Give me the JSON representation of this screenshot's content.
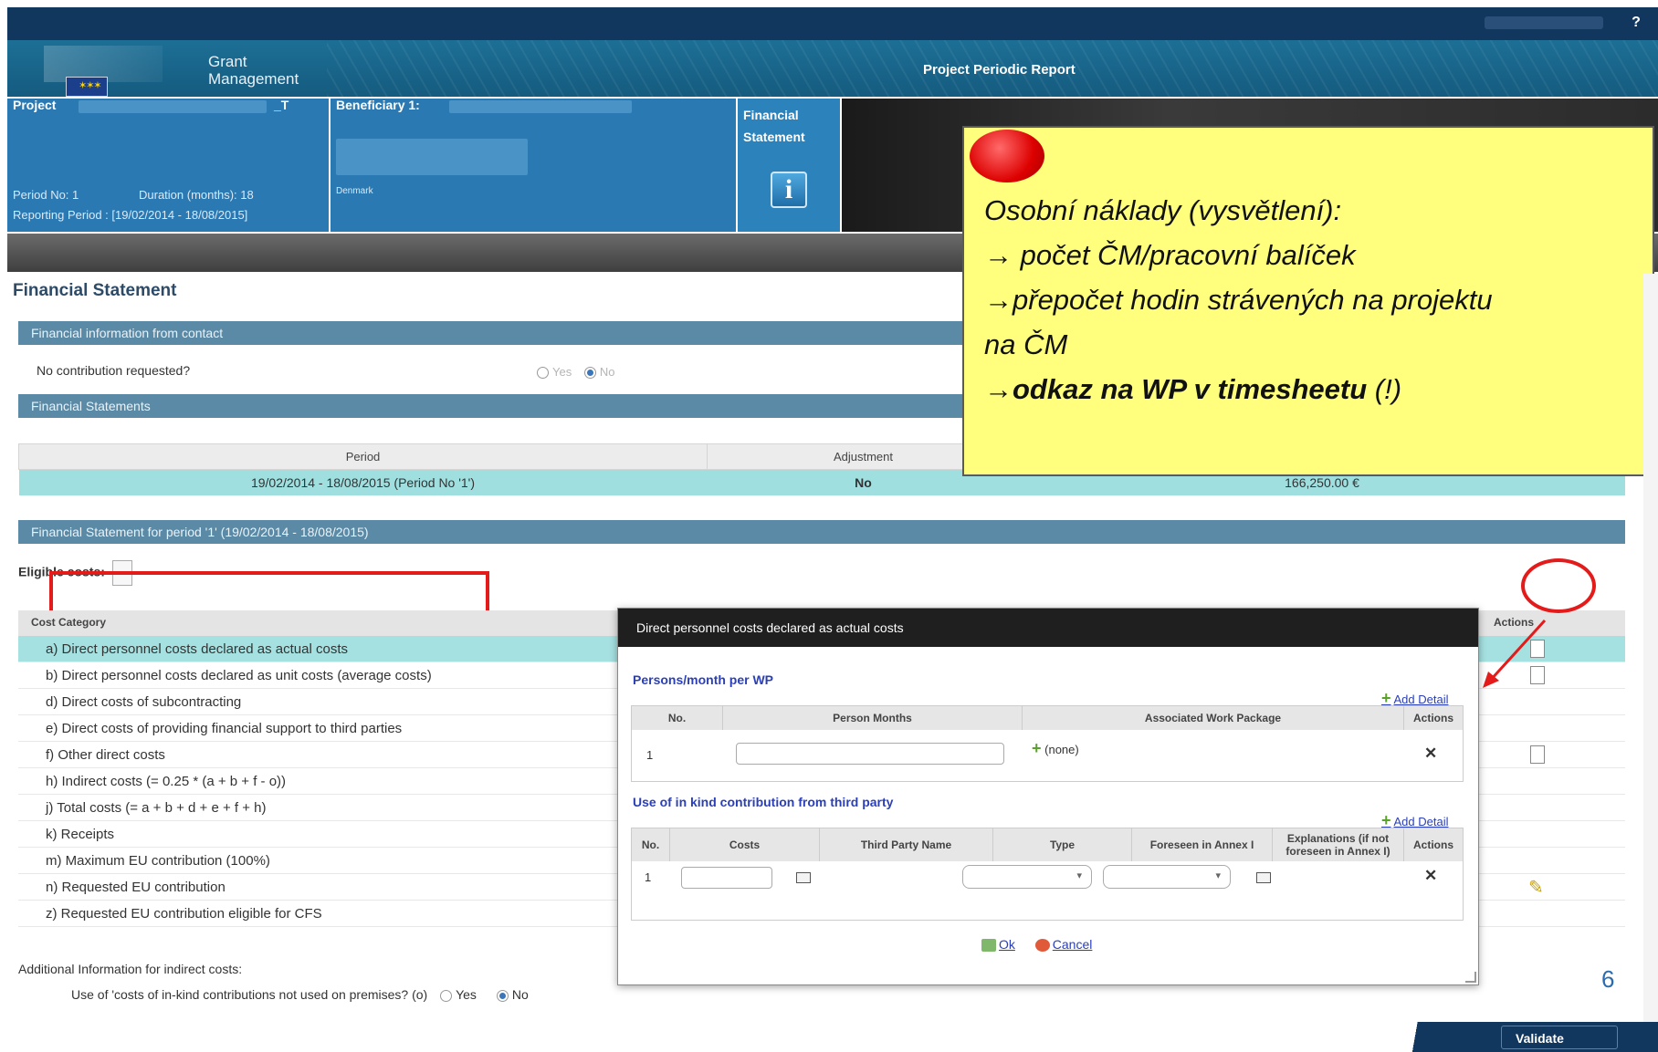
{
  "topbar": {
    "help_label": "?"
  },
  "header": {
    "app_name_line1": "Grant",
    "app_name_line2": "Management",
    "page_title": "Project Periodic Report"
  },
  "project": {
    "label": "Project",
    "acronym_suffix": "_T",
    "period_no": "Period No: 1",
    "duration": "Duration (months): 18",
    "reporting_period": "Reporting Period : [19/02/2014 - 18/08/2015]"
  },
  "beneficiary": {
    "label": "Beneficiary 1:",
    "country": "Denmark"
  },
  "financial_tab": {
    "line1": "Financial",
    "line2": "Statement",
    "icon": "info-icon"
  },
  "section_title": "Financial Statement",
  "fin_info": {
    "header": "Financial information from contact",
    "question": "No contribution requested?",
    "opt_yes": "Yes",
    "opt_no": "No"
  },
  "fin_statements": {
    "header": "Financial Statements",
    "col_period": "Period",
    "col_adjustment": "Adjustment",
    "row_period": "19/02/2014 - 18/08/2015 (Period No '1')",
    "row_adjustment": "No",
    "row_amount": "166,250.00 €"
  },
  "period_statement": {
    "header": "Financial Statement for period '1' (19/02/2014 - 18/08/2015)",
    "eligible_label": "Eligible costs:",
    "col_category": "Cost Category",
    "col_actions": "Actions",
    "rows": [
      {
        "label": "a) Direct personnel costs declared as actual costs",
        "action": "doc"
      },
      {
        "label": "b) Direct personnel costs declared as unit costs (average costs)",
        "action": "doc"
      },
      {
        "label": "d) Direct costs of subcontracting",
        "action": ""
      },
      {
        "label": "e) Direct costs of providing financial support to third parties",
        "action": ""
      },
      {
        "label": "f) Other direct costs",
        "action": "doc"
      },
      {
        "label": "h) Indirect costs (= 0.25 * (a + b + f - o))",
        "action": ""
      },
      {
        "label": "j) Total costs (= a + b + d + e + f + h)",
        "action": ""
      },
      {
        "label": "k) Receipts",
        "action": ""
      },
      {
        "label": "m) Maximum EU contribution (100%)",
        "action": ""
      },
      {
        "label": "n) Requested EU contribution",
        "action": "edit"
      },
      {
        "label": "z) Requested EU contribution eligible for CFS",
        "action": ""
      }
    ]
  },
  "additional": {
    "title": "Additional Information for indirect costs:",
    "question": "Use of 'costs of in-kind contributions not used on premises? (o)",
    "opt_yes": "Yes",
    "opt_no": "No"
  },
  "modal": {
    "title": "Direct personnel costs declared as actual costs",
    "persons": {
      "subtitle": "Persons/month per WP",
      "add_detail": "Add Detail",
      "col_no": "No.",
      "col_pm": "Person Months",
      "col_wp": "Associated Work Package",
      "col_actions": "Actions",
      "row_no": "1",
      "row_wp": "(none)"
    },
    "inkind": {
      "subtitle": "Use of in kind contribution from third party",
      "add_detail": "Add Detail",
      "col_no": "No.",
      "col_costs": "Costs",
      "col_third": "Third Party Name",
      "col_type": "Type",
      "col_foreseen": "Foreseen in Annex I",
      "col_expl": "Explanations (if not foreseen in Annex I)",
      "col_actions": "Actions",
      "row_no": "1"
    },
    "ok": "Ok",
    "cancel": "Cancel"
  },
  "annotation": {
    "line1": "Osobní náklady (vysvětlení):",
    "line2": "→ počet ČM/pracovní balíček",
    "line3": "→přepočet hodin strávených na projektu",
    "line4": "na ČM",
    "line5_bold": "odkaz na WP v timesheetu",
    "line5_rest": " (!)",
    "arrow_prefix": "→"
  },
  "page_number": "6",
  "validate_label": "Validate",
  "colors": {
    "accent": "#11375e",
    "highlight": "#a6e1e1",
    "annotation": "#ffff7d",
    "marker": "#e41b1b"
  }
}
